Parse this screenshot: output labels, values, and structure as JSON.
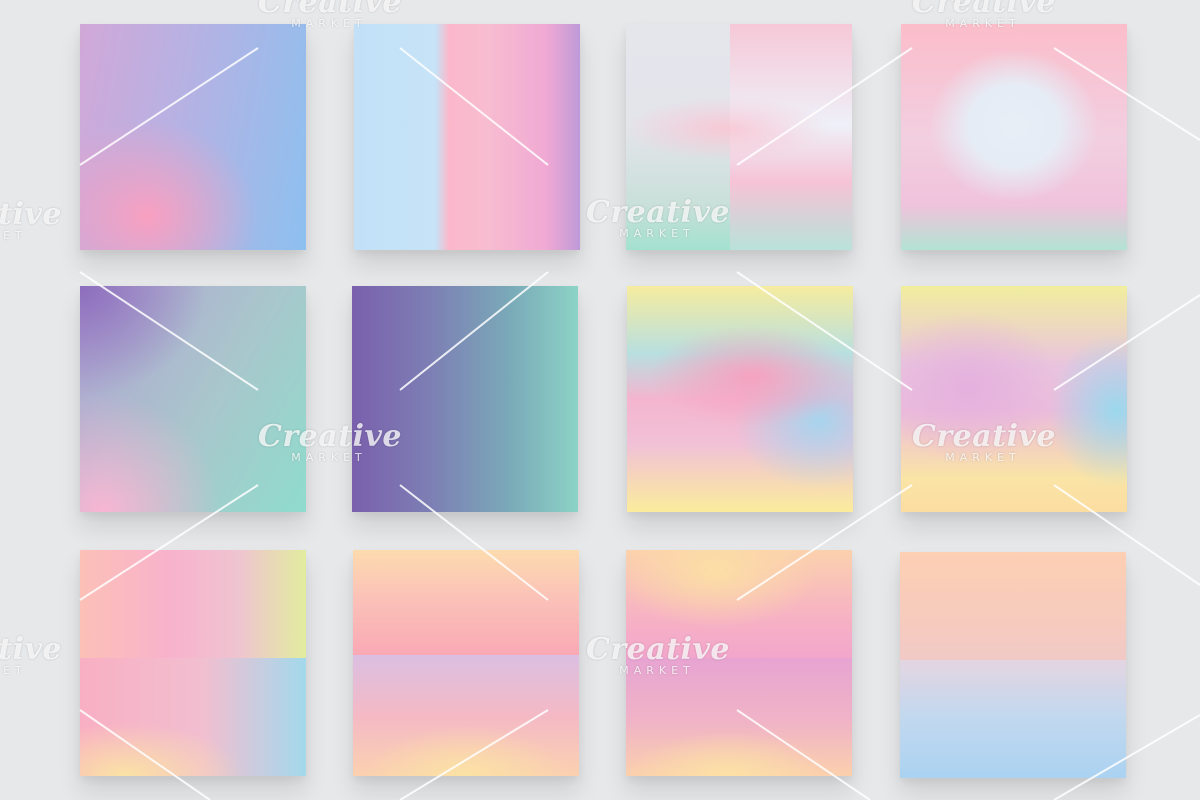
{
  "watermark": {
    "brand": "Creative",
    "sub": "MARKET"
  },
  "swatches": [
    {
      "name": "lavender-blue-pink",
      "colors": [
        "#c0a9de",
        "#8fc1ee",
        "#f7a6c4"
      ]
    },
    {
      "name": "blue-pink-purple-stripes",
      "colors": [
        "#c4e2f7",
        "#f9b8cc",
        "#c5a1dc"
      ]
    },
    {
      "name": "grey-pink-mint-quadrants",
      "colors": [
        "#e3e8f2",
        "#f8c3d2",
        "#a9e0d2"
      ]
    },
    {
      "name": "pink-white-mint-glow",
      "colors": [
        "#f9c0cd",
        "#e7edf5",
        "#b4e2d3"
      ]
    },
    {
      "name": "violet-mint-pink",
      "colors": [
        "#8c6dbd",
        "#8fd7cd",
        "#f6b8d5"
      ]
    },
    {
      "name": "purple-to-teal-gradient",
      "colors": [
        "#7a62ad",
        "#7fbdbd",
        "#94d8c9"
      ]
    },
    {
      "name": "holographic-pink-blue-yellow",
      "colors": [
        "#e2ee9a",
        "#f7a9c8",
        "#fbe79a"
      ]
    },
    {
      "name": "holographic-pink-cyan-yellow",
      "colors": [
        "#e8ec9d",
        "#e8b3dc",
        "#9ad9ee"
      ]
    },
    {
      "name": "peach-pink-yellow-blue",
      "colors": [
        "#fdd7b2",
        "#f9a8c8",
        "#9edbec"
      ]
    },
    {
      "name": "peach-pink-lilac-yellow",
      "colors": [
        "#fbd3b3",
        "#f9afb8",
        "#f4e2a7"
      ]
    },
    {
      "name": "peach-orchid-yellow",
      "colors": [
        "#fbd9b2",
        "#e39fcd",
        "#f9dea4"
      ]
    },
    {
      "name": "peach-to-sky-blue",
      "colors": [
        "#fccdb6",
        "#f3c8c5",
        "#a9d2f0"
      ]
    }
  ]
}
